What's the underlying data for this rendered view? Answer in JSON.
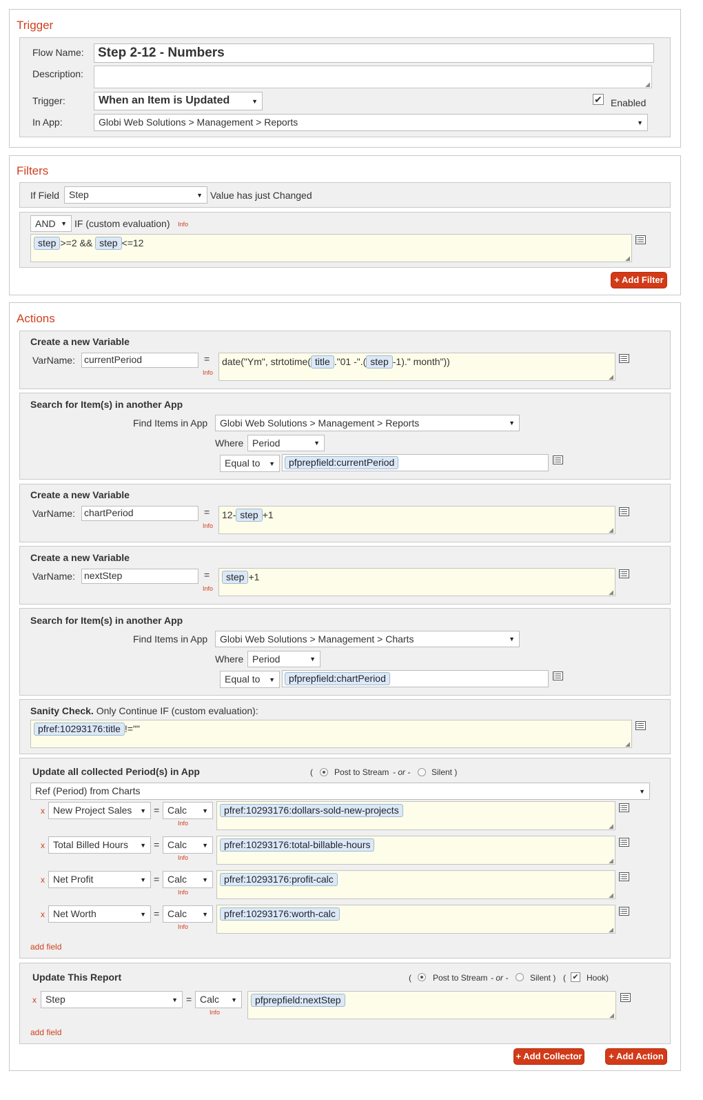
{
  "trigger": {
    "section_title": "Trigger",
    "flow_name_label": "Flow Name:",
    "flow_name_value": "Step 2-12 - Numbers",
    "description_label": "Description:",
    "description_value": "",
    "trigger_label": "Trigger:",
    "trigger_value": "When an Item is Updated",
    "enabled_label": "Enabled",
    "enabled_checked": true,
    "in_app_label": "In App:",
    "in_app_value": "Globi Web Solutions > Management > Reports"
  },
  "filters": {
    "section_title": "Filters",
    "if_field_label": "If Field",
    "if_field_value": "Step",
    "value_changed_text": "Value has just Changed",
    "logic_value": "AND",
    "custom_eval_label": "IF (custom evaluation)",
    "info_label": "Info",
    "expr": {
      "tag1": "step",
      "text1": ">=2 && ",
      "tag2": "step",
      "text2": "<=12"
    },
    "add_filter_label": "+ Add Filter"
  },
  "actions": {
    "section_title": "Actions",
    "var1": {
      "title": "Create a new Variable",
      "varname_label": "VarName:",
      "varname_value": "currentPeriod",
      "eq": "=",
      "info": "Info",
      "expr": {
        "t1": "date(\"Ym\", strtotime(",
        "tag1": "title",
        "t2": ".\"01 -\".(",
        "tag2": "step",
        "t3": "-1).\" month\"))"
      }
    },
    "search1": {
      "title": "Search for Item(s) in another App",
      "find_label": "Find Items in App",
      "find_value": "Globi Web Solutions > Management > Reports",
      "where_label": "Where",
      "where_value": "Period",
      "op_value": "Equal to",
      "match_tag": "pfprepfield:currentPeriod"
    },
    "var2": {
      "title": "Create a new Variable",
      "varname_label": "VarName:",
      "varname_value": "chartPeriod",
      "eq": "=",
      "info": "Info",
      "expr": {
        "t1": "12-",
        "tag1": "step",
        "t2": "+1"
      }
    },
    "var3": {
      "title": "Create a new Variable",
      "varname_label": "VarName:",
      "varname_value": "nextStep",
      "eq": "=",
      "info": "Info",
      "expr": {
        "tag1": "step",
        "t1": "+1"
      }
    },
    "search2": {
      "title": "Search for Item(s) in another App",
      "find_label": "Find Items in App",
      "find_value": "Globi Web Solutions > Management > Charts",
      "where_label": "Where",
      "where_value": "Period",
      "op_value": "Equal to",
      "match_tag": "pfprepfield:chartPeriod"
    },
    "sanity": {
      "title": "Sanity Check.",
      "subtitle": "Only Continue IF (custom evaluation):",
      "expr_tag": "pfref:10293176:title",
      "expr_text": "!=\"\""
    },
    "update_collected": {
      "title": "Update all collected Period(s) in App",
      "paren_open": "(",
      "post_label": "Post to Stream",
      "or_label": "- or -",
      "silent_label": "Silent )",
      "ref_value": "Ref (Period) from Charts",
      "x": "x",
      "eq": "=",
      "calc": "Calc",
      "info": "Info",
      "rows": [
        {
          "field": "New Project Sales",
          "value": "pfref:10293176:dollars-sold-new-projects"
        },
        {
          "field": "Total Billed Hours",
          "value": "pfref:10293176:total-billable-hours"
        },
        {
          "field": "Net Profit",
          "value": "pfref:10293176:profit-calc"
        },
        {
          "field": "Net Worth",
          "value": "pfref:10293176:worth-calc"
        }
      ],
      "add_field": "add field"
    },
    "update_report": {
      "title": "Update This Report",
      "paren_open": "(",
      "post_label": "Post to Stream",
      "or_label": "- or -",
      "silent_label": "Silent )",
      "hook_open": "(",
      "hook_label": "Hook)",
      "x": "x",
      "field": "Step",
      "eq": "=",
      "calc": "Calc",
      "info": "Info",
      "value": "pfprepfield:nextStep",
      "add_field": "add field"
    },
    "add_collector_label": "+ Add Collector",
    "add_action_label": "+ Add Action"
  }
}
